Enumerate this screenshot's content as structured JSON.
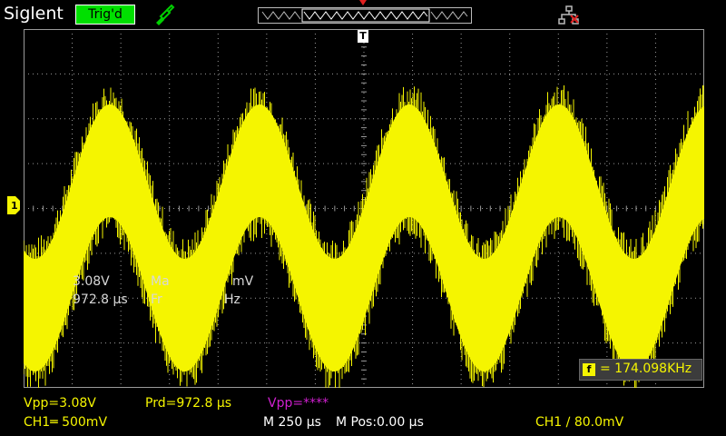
{
  "header": {
    "brand": "Siglent",
    "trigger_status": "Trig'd",
    "icons": {
      "probe": "probe-icon",
      "network": "network-disconnected-icon",
      "trigger_position": "trigger-position-marker"
    }
  },
  "display": {
    "trigger_marker": "T",
    "channel_marker": "1",
    "overlay_left": "3.08V",
    "overlay_left2": "972.8 µs",
    "overlay_mid": "Ma",
    "overlay_mid_tail": "mV",
    "overlay_mid2": "Fr",
    "overlay_mid2_tail": "Hz",
    "frequency_counter": "= 174.098KHz",
    "frequency_icon": "f"
  },
  "measurements": {
    "vpp_ch1": "Vpp=3.08V",
    "period": "Prd=972.8 µs",
    "vpp_math": "Vpp=****"
  },
  "status": {
    "ch1_scale": "CH1═ 500mV",
    "timebase": "M 250 µs",
    "mpos": "M Pos:0.00 µs",
    "trigger": "CH1 ∕ 80.0mV"
  },
  "colors": {
    "ch1": "#f5f500",
    "math": "#d020d0",
    "trig_ok": "#00e000",
    "grid": "#9a9a9a"
  }
}
